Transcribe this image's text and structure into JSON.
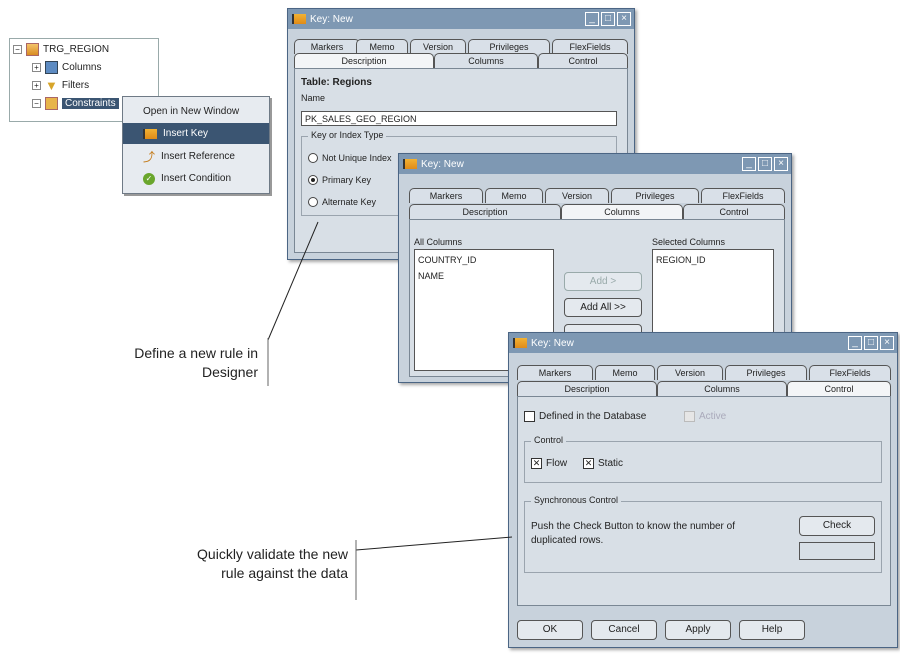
{
  "tree": {
    "root": "TRG_REGION",
    "items": [
      "Columns",
      "Filters",
      "Constraints"
    ]
  },
  "context_menu": {
    "items": [
      "Open in New Window",
      "Insert Key",
      "Insert Reference",
      "Insert Condition"
    ],
    "selected": "Insert Key"
  },
  "dialog1": {
    "title": "Key: New",
    "tabs_back": [
      "Markers",
      "Memo",
      "Version",
      "Privileges",
      "FlexFields"
    ],
    "tabs_front": [
      "Description",
      "Columns",
      "Control"
    ],
    "table_label": "Table: Regions",
    "name_label": "Name",
    "name_value": "PK_SALES_GEO_REGION",
    "group_label": "Key or Index Type",
    "radios": [
      "Not Unique Index",
      "Primary Key",
      "Alternate Key"
    ],
    "selected_radio": "Primary Key"
  },
  "dialog2": {
    "title": "Key: New",
    "tabs_back": [
      "Markers",
      "Memo",
      "Version",
      "Privileges",
      "FlexFields"
    ],
    "tabs_front": [
      "Description",
      "Columns",
      "Control"
    ],
    "all_columns_label": "All Columns",
    "all_columns": [
      "COUNTRY_ID",
      "NAME"
    ],
    "selected_columns_label": "Selected Columns",
    "selected_columns": [
      "REGION_ID"
    ],
    "add_label": "Add >",
    "add_all_label": "Add All >>"
  },
  "dialog3": {
    "title": "Key: New",
    "tabs_back": [
      "Markers",
      "Memo",
      "Version",
      "Privileges",
      "FlexFields"
    ],
    "tabs_front": [
      "Description",
      "Columns",
      "Control"
    ],
    "defined_label": "Defined in the Database",
    "active_label": "Active",
    "control_group_label": "Control",
    "flow_label": "Flow",
    "static_label": "Static",
    "sync_group_label": "Synchronous Control",
    "sync_text": "Push the Check Button to know the number of duplicated rows.",
    "check_label": "Check",
    "buttons": [
      "OK",
      "Cancel",
      "Apply",
      "Help"
    ]
  },
  "captions": {
    "define": "Define a new rule in Designer",
    "validate": "Quickly validate the new rule against the data"
  },
  "colors": {
    "titlebar": "#7e98b3",
    "menu_selected": "#3b5572",
    "dialog_bg": "#c8d2dc"
  }
}
